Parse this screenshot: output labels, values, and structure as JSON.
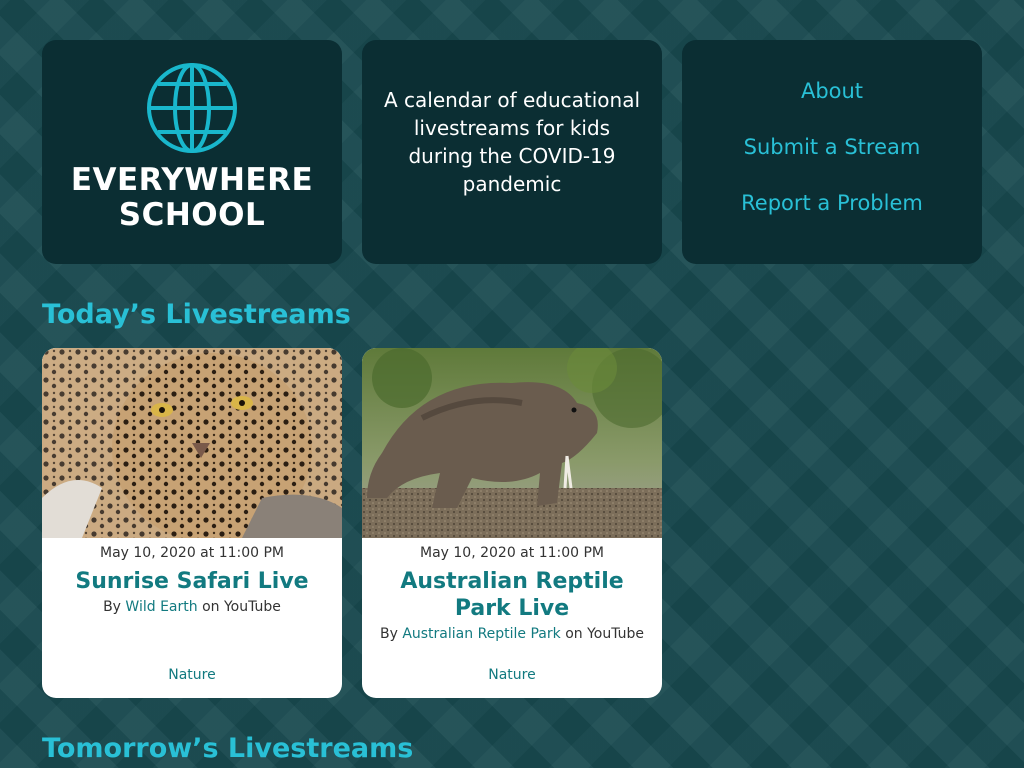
{
  "brand": {
    "line1": "EVERYWHERE",
    "line2": "SCHOOL",
    "icon": "globe-icon"
  },
  "tagline": "A calendar of educational livestreams for kids during the COVID-19 pandemic",
  "nav": {
    "about": "About",
    "submit": "Submit a Stream",
    "report": "Report a Problem"
  },
  "sections": {
    "today": "Today’s Livestreams",
    "tomorrow": "Tomorrow’s Livestreams"
  },
  "cards": [
    {
      "date": "May 10, 2020 at 11:00 PM",
      "title": "Sunrise Safari Live",
      "by": "By",
      "source": "Wild Earth",
      "platform": "on YouTube",
      "tag": "Nature",
      "image": "leopard-photo"
    },
    {
      "date": "May 10, 2020 at 11:00 PM",
      "title": "Australian Reptile Park Live",
      "by": "By",
      "source": "Australian Reptile Park",
      "platform": "on YouTube",
      "tag": "Nature",
      "image": "komodo-dragon-photo"
    }
  ],
  "colors": {
    "accent": "#29c0d6",
    "panel": "#0b2e33",
    "link": "#127a80",
    "background": "#194a50"
  }
}
